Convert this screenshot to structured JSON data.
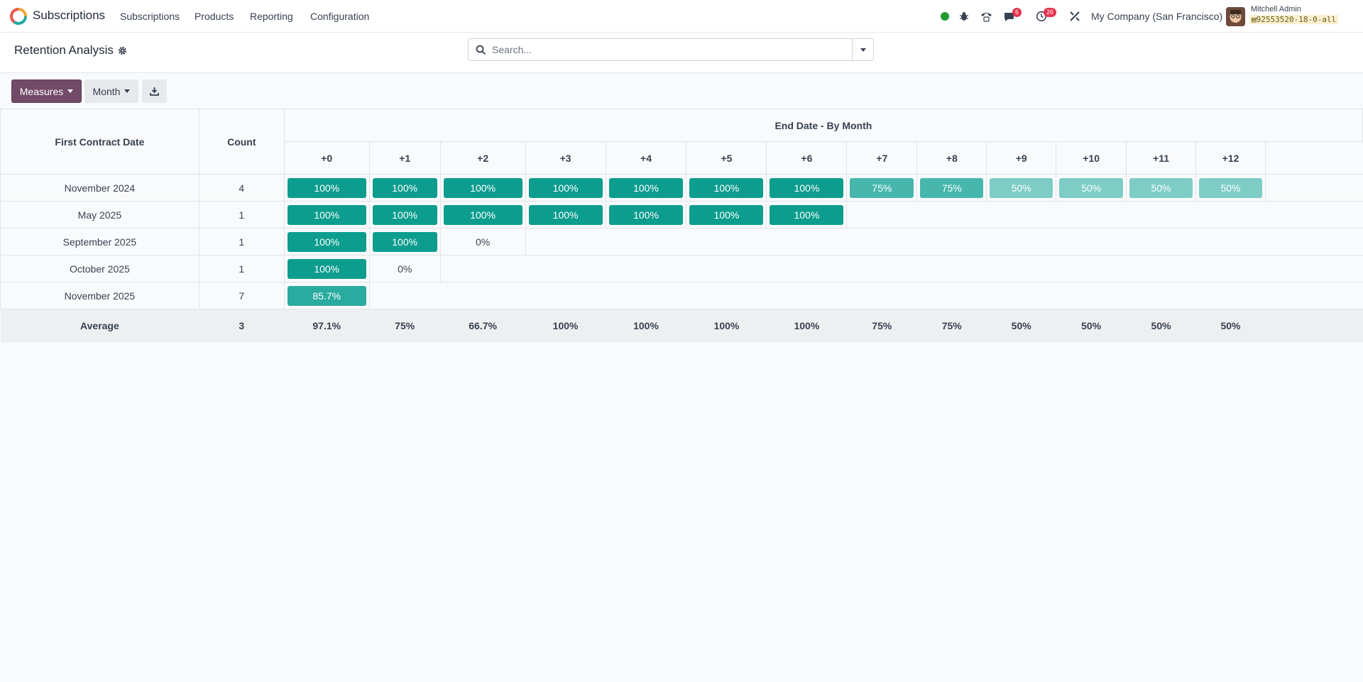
{
  "navbar": {
    "app_name": "Subscriptions",
    "menu": [
      "Subscriptions",
      "Products",
      "Reporting",
      "Configuration"
    ],
    "messages_badge": "6",
    "activities_badge": "26",
    "company": "My Company (San Francisco)",
    "user_name": "Mitchell Admin",
    "db_name": "92553520-18-0-all"
  },
  "control": {
    "title": "Retention Analysis",
    "search_placeholder": "Search..."
  },
  "toolbar": {
    "measures_label": "Measures",
    "interval_label": "Month"
  },
  "table": {
    "row_header": "First Contract Date",
    "count_header": "Count",
    "group_header": "End Date - By Month",
    "columns": [
      "+0",
      "+1",
      "+2",
      "+3",
      "+4",
      "+5",
      "+6",
      "+7",
      "+8",
      "+9",
      "+10",
      "+11",
      "+12"
    ],
    "rows": [
      {
        "label": "November 2024",
        "count": "4",
        "values": [
          "100%",
          "100%",
          "100%",
          "100%",
          "100%",
          "100%",
          "100%",
          "75%",
          "75%",
          "50%",
          "50%",
          "50%",
          "50%"
        ],
        "levels": [
          1,
          1,
          1,
          1,
          1,
          1,
          1,
          0.75,
          0.75,
          0.5,
          0.5,
          0.5,
          0.5
        ]
      },
      {
        "label": "May 2025",
        "count": "1",
        "values": [
          "100%",
          "100%",
          "100%",
          "100%",
          "100%",
          "100%",
          "100%"
        ],
        "levels": [
          1,
          1,
          1,
          1,
          1,
          1,
          1
        ]
      },
      {
        "label": "September 2025",
        "count": "1",
        "values": [
          "100%",
          "100%",
          "0%"
        ],
        "levels": [
          1,
          1,
          0
        ]
      },
      {
        "label": "October 2025",
        "count": "1",
        "values": [
          "100%",
          "0%"
        ],
        "levels": [
          1,
          0
        ]
      },
      {
        "label": "November 2025",
        "count": "7",
        "values": [
          "85.7%"
        ],
        "levels": [
          0.857
        ]
      }
    ],
    "average": {
      "label": "Average",
      "count": "3",
      "values": [
        "97.1%",
        "75%",
        "66.7%",
        "100%",
        "100%",
        "100%",
        "100%",
        "75%",
        "75%",
        "50%",
        "50%",
        "50%",
        "50%"
      ]
    }
  },
  "colors": {
    "full": "#0d9d8f",
    "high": "#2aaba0",
    "mid": "#47b7ae",
    "low": "#7dcdc6",
    "brand": "#714b67"
  }
}
